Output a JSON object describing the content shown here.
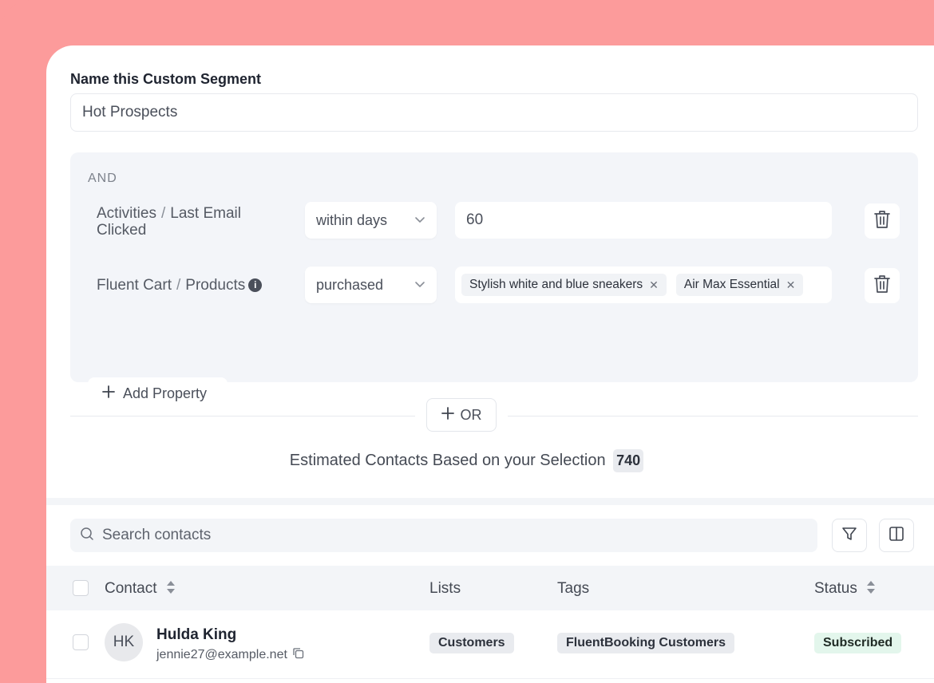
{
  "segment": {
    "label": "Name this Custom Segment",
    "name_value": "Hot Prospects"
  },
  "conditions": {
    "group_operator": "AND",
    "rules": [
      {
        "category": "Activities",
        "separator": "/",
        "property": "Last Email",
        "property_line2": "Clicked",
        "operator": "within days",
        "value": "60"
      },
      {
        "category": "Fluent Cart",
        "separator": "/",
        "property": "Products",
        "info_icon": "i",
        "operator": "purchased",
        "chips": [
          "Stylish white and blue sneakers",
          "Air Max Essential"
        ]
      }
    ],
    "add_property_label": "Add Property"
  },
  "or_button_label": "OR",
  "estimate": {
    "text": "Estimated Contacts Based on your Selection",
    "count": "740"
  },
  "contacts": {
    "search_placeholder": "Search contacts",
    "columns": {
      "contact": "Contact",
      "lists": "Lists",
      "tags": "Tags",
      "status": "Status"
    },
    "rows": [
      {
        "initials": "HK",
        "name": "Hulda King",
        "email": "jennie27@example.net",
        "list": "Customers",
        "tag": "FluentBooking Customers",
        "status": "Subscribed"
      }
    ]
  },
  "colors": {
    "background": "#fc9b9b",
    "panel": "#ffffff",
    "condition_bg": "#f3f5f9",
    "status_subscribed_bg": "#e3f6ec"
  }
}
